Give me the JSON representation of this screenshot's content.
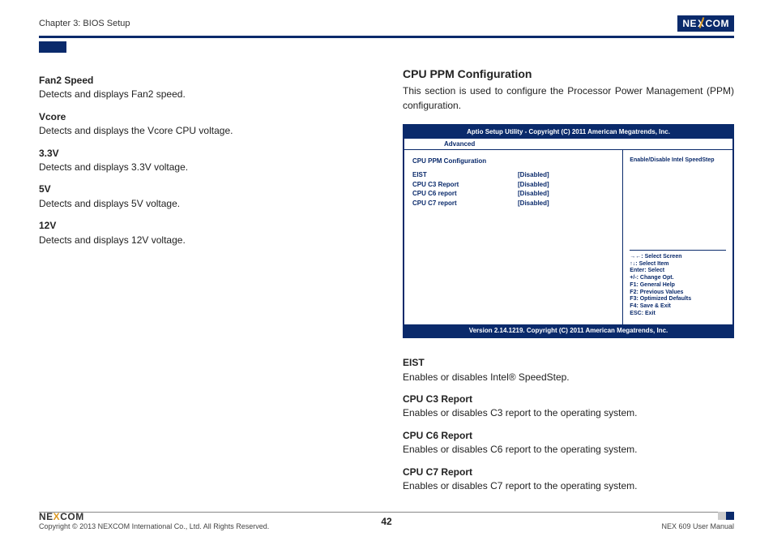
{
  "chapter": "Chapter 3: BIOS Setup",
  "logo_text_1": "NE",
  "logo_text_x": "X",
  "logo_text_2": "COM",
  "left": {
    "h1": "Fan2 Speed",
    "p1": "Detects and displays Fan2 speed.",
    "h2": "Vcore",
    "p2": "Detects and displays the Vcore CPU voltage.",
    "h3": "3.3V",
    "p3": "Detects and displays 3.3V voltage.",
    "h4": "5V",
    "p4": "Detects and displays 5V voltage.",
    "h5": "12V",
    "p5": "Detects and displays 12V voltage."
  },
  "right": {
    "title": "CPU PPM Configuration",
    "intro": "This section is used to configure the Processor Power Management (PPM) configuration.",
    "h1": "EIST",
    "p1": "Enables or disables Intel® SpeedStep.",
    "h2": "CPU C3 Report",
    "p2": "Enables or disables C3 report to the operating system.",
    "h3": "CPU C6 Report",
    "p3": "Enables or disables C6 report to the operating system.",
    "h4": "CPU C7 Report",
    "p4": "Enables or disables C7 report to the operating system."
  },
  "bios": {
    "title": "Aptio Setup Utility - Copyright (C) 2011 American Megatrends, Inc.",
    "tab": "Advanced",
    "section": "CPU PPM Configuration",
    "rows": {
      "r1k": "EIST",
      "r1v": "[Disabled]",
      "r2k": "CPU C3 Report",
      "r2v": "[Disabled]",
      "r3k": "CPU C6 report",
      "r3v": "[Disabled]",
      "r4k": "CPU C7 report",
      "r4v": "[Disabled]"
    },
    "help": "Enable/Disable Intel SpeedStep",
    "keys": {
      "k1": "→←: Select Screen",
      "k2": "↑↓: Select Item",
      "k3": "Enter: Select",
      "k4": "+/-: Change Opt.",
      "k5": "F1: General Help",
      "k6": "F2: Previous Values",
      "k7": "F3: Optimized Defaults",
      "k8": "F4: Save & Exit",
      "k9": "ESC: Exit"
    },
    "footer": "Version 2.14.1219. Copyright (C) 2011 American Megatrends, Inc."
  },
  "footer": {
    "copyright": "Copyright © 2013 NEXCOM International Co., Ltd. All Rights Reserved.",
    "page": "42",
    "manual": "NEX 609 User Manual"
  }
}
